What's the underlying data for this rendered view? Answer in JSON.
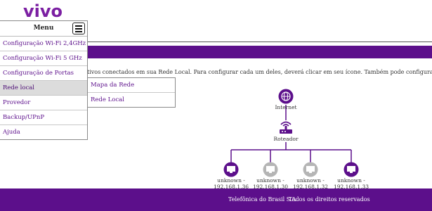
{
  "brand": {
    "logo_text": "vivo",
    "accent": "#5c0f8b"
  },
  "menu": {
    "title": "Menu",
    "items": [
      {
        "label": "Configuração Wi-Fi 2,4GHz"
      },
      {
        "label": "Configuração Wi-Fi 5 GHz"
      },
      {
        "label": "Configuração de Portas"
      },
      {
        "label": "Rede local",
        "active": true
      },
      {
        "label": "Provedor"
      },
      {
        "label": "Backup/UPnP"
      },
      {
        "label": "Ajuda"
      }
    ]
  },
  "submenu": {
    "items": [
      {
        "label": "Mapa da Rede"
      },
      {
        "label": "Rede Local"
      }
    ]
  },
  "intro_text": "tivos conectados em sua Rede Local. Para configurar cada um deles, deverá clicar em seu ícone. Também pode configurar sua Rede Local clicando no",
  "network": {
    "internet_label": "Internet",
    "router_label": "Roteador",
    "devices": [
      {
        "name": "unknown -",
        "ip": "192.168.1.36",
        "status": "active"
      },
      {
        "name": "unknown -",
        "ip": "192.168.1.30",
        "status": "inactive"
      },
      {
        "name": "unknown -",
        "ip": "192.168.1.32",
        "status": "inactive"
      },
      {
        "name": "unknown -",
        "ip": "192.168.1.33",
        "status": "active"
      }
    ]
  },
  "footer": {
    "company": "Telefônica do Brasil S.A",
    "rights": "Todos os direitos reservados"
  }
}
